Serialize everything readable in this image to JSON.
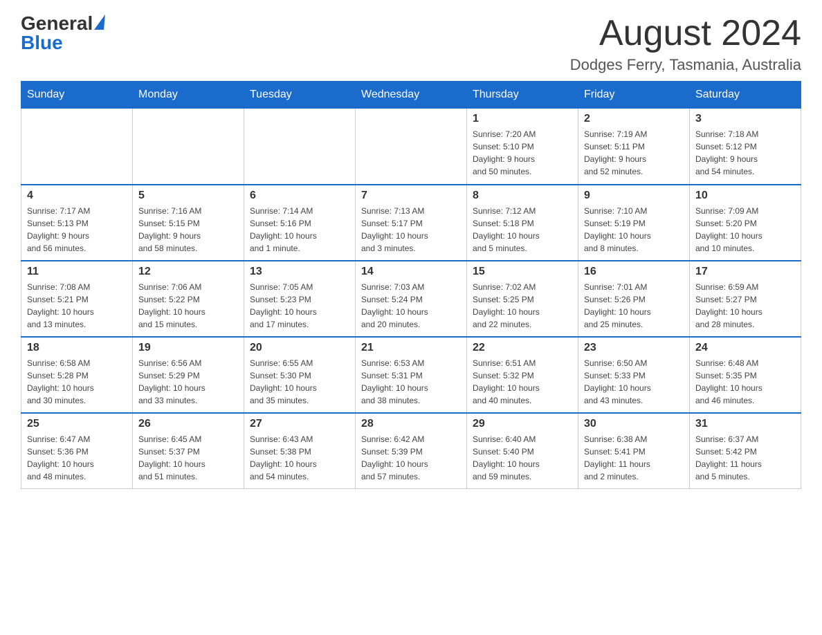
{
  "header": {
    "logo_general": "General",
    "logo_blue": "Blue",
    "month_year": "August 2024",
    "location": "Dodges Ferry, Tasmania, Australia"
  },
  "days_of_week": [
    "Sunday",
    "Monday",
    "Tuesday",
    "Wednesday",
    "Thursday",
    "Friday",
    "Saturday"
  ],
  "weeks": [
    {
      "days": [
        {
          "number": "",
          "info": ""
        },
        {
          "number": "",
          "info": ""
        },
        {
          "number": "",
          "info": ""
        },
        {
          "number": "",
          "info": ""
        },
        {
          "number": "1",
          "info": "Sunrise: 7:20 AM\nSunset: 5:10 PM\nDaylight: 9 hours\nand 50 minutes."
        },
        {
          "number": "2",
          "info": "Sunrise: 7:19 AM\nSunset: 5:11 PM\nDaylight: 9 hours\nand 52 minutes."
        },
        {
          "number": "3",
          "info": "Sunrise: 7:18 AM\nSunset: 5:12 PM\nDaylight: 9 hours\nand 54 minutes."
        }
      ]
    },
    {
      "days": [
        {
          "number": "4",
          "info": "Sunrise: 7:17 AM\nSunset: 5:13 PM\nDaylight: 9 hours\nand 56 minutes."
        },
        {
          "number": "5",
          "info": "Sunrise: 7:16 AM\nSunset: 5:15 PM\nDaylight: 9 hours\nand 58 minutes."
        },
        {
          "number": "6",
          "info": "Sunrise: 7:14 AM\nSunset: 5:16 PM\nDaylight: 10 hours\nand 1 minute."
        },
        {
          "number": "7",
          "info": "Sunrise: 7:13 AM\nSunset: 5:17 PM\nDaylight: 10 hours\nand 3 minutes."
        },
        {
          "number": "8",
          "info": "Sunrise: 7:12 AM\nSunset: 5:18 PM\nDaylight: 10 hours\nand 5 minutes."
        },
        {
          "number": "9",
          "info": "Sunrise: 7:10 AM\nSunset: 5:19 PM\nDaylight: 10 hours\nand 8 minutes."
        },
        {
          "number": "10",
          "info": "Sunrise: 7:09 AM\nSunset: 5:20 PM\nDaylight: 10 hours\nand 10 minutes."
        }
      ]
    },
    {
      "days": [
        {
          "number": "11",
          "info": "Sunrise: 7:08 AM\nSunset: 5:21 PM\nDaylight: 10 hours\nand 13 minutes."
        },
        {
          "number": "12",
          "info": "Sunrise: 7:06 AM\nSunset: 5:22 PM\nDaylight: 10 hours\nand 15 minutes."
        },
        {
          "number": "13",
          "info": "Sunrise: 7:05 AM\nSunset: 5:23 PM\nDaylight: 10 hours\nand 17 minutes."
        },
        {
          "number": "14",
          "info": "Sunrise: 7:03 AM\nSunset: 5:24 PM\nDaylight: 10 hours\nand 20 minutes."
        },
        {
          "number": "15",
          "info": "Sunrise: 7:02 AM\nSunset: 5:25 PM\nDaylight: 10 hours\nand 22 minutes."
        },
        {
          "number": "16",
          "info": "Sunrise: 7:01 AM\nSunset: 5:26 PM\nDaylight: 10 hours\nand 25 minutes."
        },
        {
          "number": "17",
          "info": "Sunrise: 6:59 AM\nSunset: 5:27 PM\nDaylight: 10 hours\nand 28 minutes."
        }
      ]
    },
    {
      "days": [
        {
          "number": "18",
          "info": "Sunrise: 6:58 AM\nSunset: 5:28 PM\nDaylight: 10 hours\nand 30 minutes."
        },
        {
          "number": "19",
          "info": "Sunrise: 6:56 AM\nSunset: 5:29 PM\nDaylight: 10 hours\nand 33 minutes."
        },
        {
          "number": "20",
          "info": "Sunrise: 6:55 AM\nSunset: 5:30 PM\nDaylight: 10 hours\nand 35 minutes."
        },
        {
          "number": "21",
          "info": "Sunrise: 6:53 AM\nSunset: 5:31 PM\nDaylight: 10 hours\nand 38 minutes."
        },
        {
          "number": "22",
          "info": "Sunrise: 6:51 AM\nSunset: 5:32 PM\nDaylight: 10 hours\nand 40 minutes."
        },
        {
          "number": "23",
          "info": "Sunrise: 6:50 AM\nSunset: 5:33 PM\nDaylight: 10 hours\nand 43 minutes."
        },
        {
          "number": "24",
          "info": "Sunrise: 6:48 AM\nSunset: 5:35 PM\nDaylight: 10 hours\nand 46 minutes."
        }
      ]
    },
    {
      "days": [
        {
          "number": "25",
          "info": "Sunrise: 6:47 AM\nSunset: 5:36 PM\nDaylight: 10 hours\nand 48 minutes."
        },
        {
          "number": "26",
          "info": "Sunrise: 6:45 AM\nSunset: 5:37 PM\nDaylight: 10 hours\nand 51 minutes."
        },
        {
          "number": "27",
          "info": "Sunrise: 6:43 AM\nSunset: 5:38 PM\nDaylight: 10 hours\nand 54 minutes."
        },
        {
          "number": "28",
          "info": "Sunrise: 6:42 AM\nSunset: 5:39 PM\nDaylight: 10 hours\nand 57 minutes."
        },
        {
          "number": "29",
          "info": "Sunrise: 6:40 AM\nSunset: 5:40 PM\nDaylight: 10 hours\nand 59 minutes."
        },
        {
          "number": "30",
          "info": "Sunrise: 6:38 AM\nSunset: 5:41 PM\nDaylight: 11 hours\nand 2 minutes."
        },
        {
          "number": "31",
          "info": "Sunrise: 6:37 AM\nSunset: 5:42 PM\nDaylight: 11 hours\nand 5 minutes."
        }
      ]
    }
  ]
}
